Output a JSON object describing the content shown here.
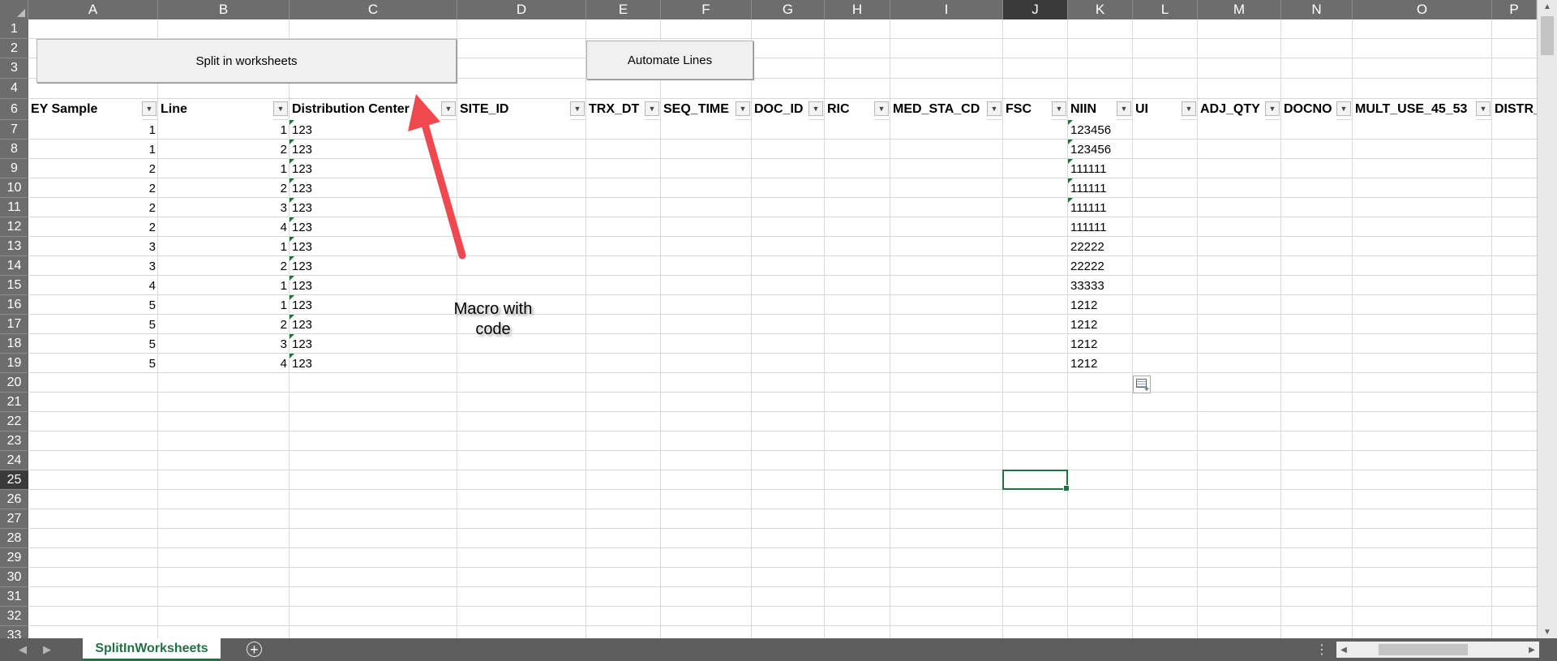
{
  "columns": [
    "A",
    "B",
    "C",
    "D",
    "E",
    "F",
    "G",
    "H",
    "I",
    "J",
    "K",
    "L",
    "M",
    "N",
    "O",
    "P"
  ],
  "rows": [
    "1",
    "2",
    "3",
    "4",
    "6",
    "7",
    "8",
    "9",
    "10",
    "11",
    "12",
    "13",
    "14",
    "15",
    "16",
    "17",
    "18",
    "19",
    "20",
    "21",
    "22",
    "23",
    "24",
    "25",
    "26",
    "27",
    "28",
    "29",
    "30",
    "31",
    "32",
    "33"
  ],
  "selected_column": "J",
  "selected_row": "25",
  "buttons": {
    "split": "Split in worksheets",
    "automate": "Automate Lines"
  },
  "headers": [
    "EY Sample",
    "Line",
    "Distribution Center",
    "SITE_ID",
    "TRX_DT",
    "SEQ_TIME",
    "DOC_ID",
    "RIC",
    "MED_STA_CD",
    "FSC",
    "NIIN",
    "UI",
    "ADJ_QTY",
    "DOCNO",
    "MULT_USE_45_53",
    "DISTR_"
  ],
  "data_rows": [
    {
      "sample": "1",
      "line": "1",
      "dc": "123",
      "niin": "123456"
    },
    {
      "sample": "1",
      "line": "2",
      "dc": "123",
      "niin": "123456"
    },
    {
      "sample": "2",
      "line": "1",
      "dc": "123",
      "niin": "111111"
    },
    {
      "sample": "2",
      "line": "2",
      "dc": "123",
      "niin": "111111"
    },
    {
      "sample": "2",
      "line": "3",
      "dc": "123",
      "niin": "111111"
    },
    {
      "sample": "2",
      "line": "4",
      "dc": "123",
      "niin": "111111"
    },
    {
      "sample": "3",
      "line": "1",
      "dc": "123",
      "niin": "22222"
    },
    {
      "sample": "3",
      "line": "2",
      "dc": "123",
      "niin": "22222"
    },
    {
      "sample": "4",
      "line": "1",
      "dc": "123",
      "niin": "33333"
    },
    {
      "sample": "5",
      "line": "1",
      "dc": "123",
      "niin": "1212"
    },
    {
      "sample": "5",
      "line": "2",
      "dc": "123",
      "niin": "1212"
    },
    {
      "sample": "5",
      "line": "3",
      "dc": "123",
      "niin": "1212"
    },
    {
      "sample": "5",
      "line": "4",
      "dc": "123",
      "niin": "1212"
    }
  ],
  "annotation": {
    "line1": "Macro with",
    "line2": "code",
    "arrow_color": "#f0484f"
  },
  "sheet_tab": "SplitInWorksheets",
  "icons": {
    "filter": "filter-dropdown-icon",
    "add_sheet": "plus-circle-icon",
    "paste_options": "paste-options-icon",
    "more": "more-dots-icon"
  },
  "colors": {
    "accent": "#217346",
    "header_bg": "#6d6d6d",
    "selected_header_bg": "#3a3a3a"
  }
}
